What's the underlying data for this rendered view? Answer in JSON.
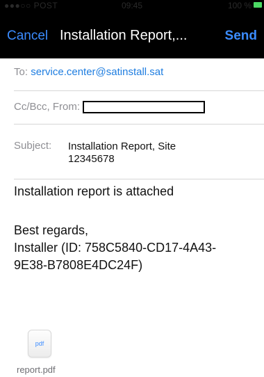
{
  "status_bar": {
    "carrier": "●●●○○ POST",
    "time": "09:45",
    "battery": "100 %"
  },
  "nav": {
    "cancel": "Cancel",
    "title": "Installation Report,...",
    "send": "Send"
  },
  "to": {
    "label": "To:",
    "value": "service.center@satinstall.sat"
  },
  "cc": {
    "label": "Cc/Bcc, From:"
  },
  "subject": {
    "label": "Subject:",
    "line1": "Installation Report, Site",
    "line2": "12345678"
  },
  "body": {
    "line1": "Installation report is attached",
    "line2": "Best regards,",
    "line3": "Installer (ID: 758C5840-CD17-4A43-",
    "line4": "9E38-B7808E4DC24F)"
  },
  "attachment": {
    "type_label": "pdf",
    "filename": "report.pdf"
  }
}
